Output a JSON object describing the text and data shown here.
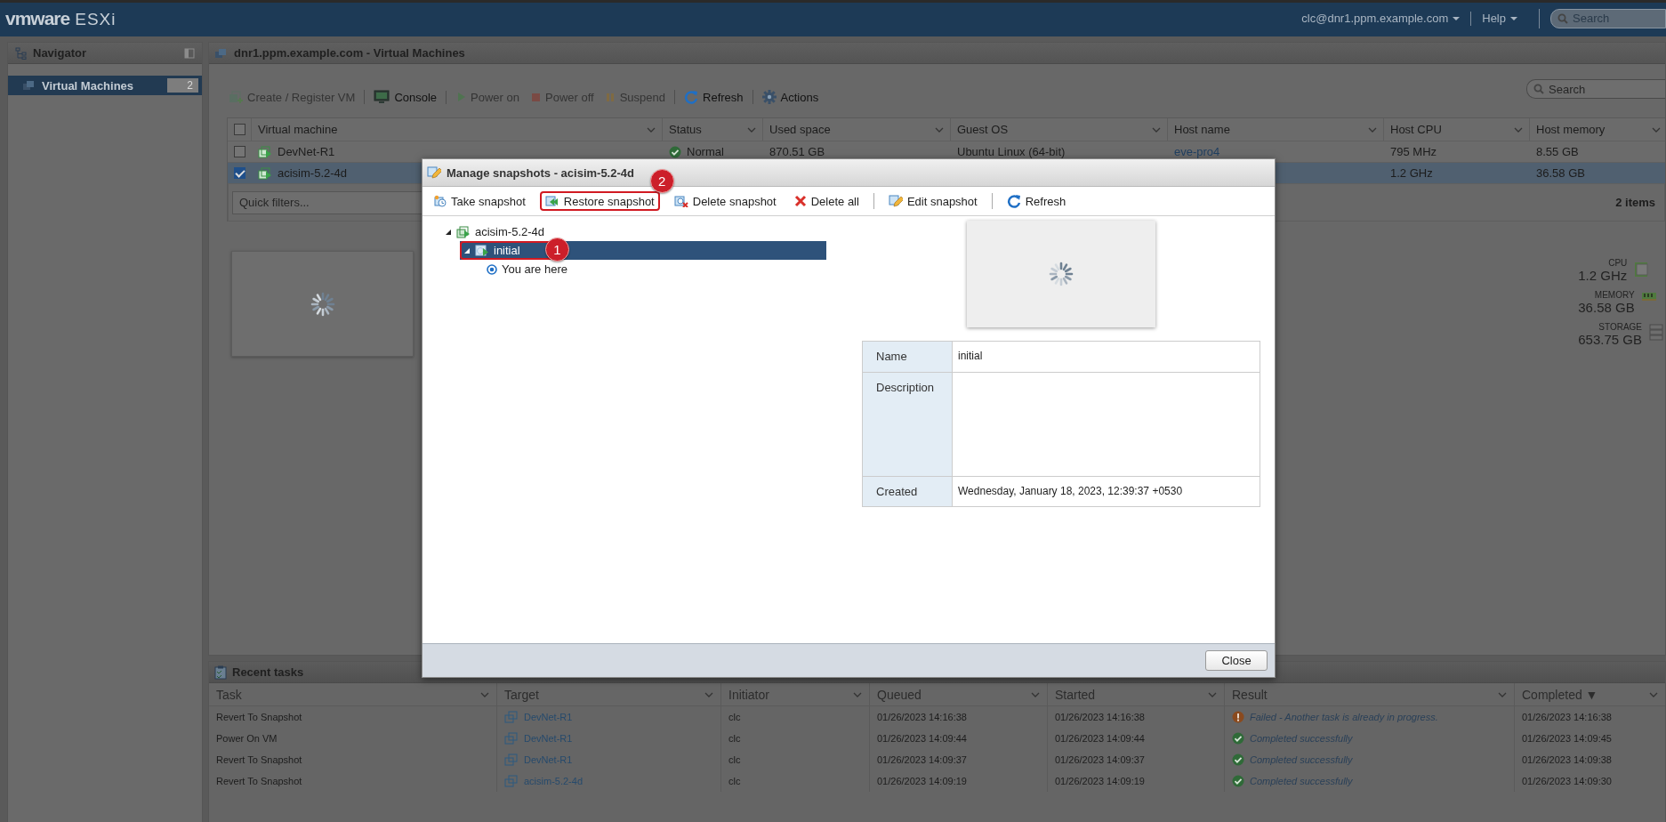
{
  "top_bar": {
    "logo": "vmware",
    "product": "ESXi",
    "user_menu": "clc@dnr1.ppm.example.com",
    "help_menu": "Help",
    "search": {
      "placeholder": "Search"
    }
  },
  "navigator": {
    "title": "Navigator",
    "items": [
      {
        "label": "Virtual Machines",
        "count": "2",
        "selected": true
      }
    ]
  },
  "main": {
    "title": "dnr1.ppm.example.com - Virtual Machines",
    "toolbar": [
      [
        {
          "label": "Create / Register VM",
          "kind": "vm-add",
          "disabled": true
        }
      ],
      [
        {
          "label": "Console",
          "kind": "console",
          "disabled": false
        }
      ],
      [
        {
          "label": "Power on",
          "kind": "power-on",
          "disabled": true
        },
        {
          "label": "Power off",
          "kind": "power-off",
          "disabled": true
        },
        {
          "label": "Suspend",
          "kind": "suspend",
          "disabled": true
        }
      ],
      [
        {
          "label": "Refresh",
          "kind": "refresh",
          "disabled": false
        }
      ],
      [
        {
          "label": "Actions",
          "kind": "actions",
          "disabled": false
        }
      ]
    ],
    "search": {
      "placeholder": "Search"
    },
    "table": {
      "select_all": {
        "checked": false
      },
      "columns": [
        "Virtual machine",
        "Status",
        "Used space",
        "Guest OS",
        "Host name",
        "Host CPU",
        "Host memory"
      ],
      "rows": [
        {
          "checked": false,
          "selected": false,
          "name": "DevNet-R1",
          "status": "Normal",
          "used_space": "870.51 GB",
          "guest_os": "Ubuntu Linux (64-bit)",
          "host_name": "eve-pro4",
          "host_cpu": "795 MHz",
          "host_memory": "8.55 GB"
        },
        {
          "checked": true,
          "selected": true,
          "name": "acisim-5.2-4d",
          "host_cpu": "1.2 GHz",
          "host_memory": "36.58 GB"
        }
      ],
      "filter_placeholder": "Quick filters...",
      "count": "2 items"
    },
    "resources": [
      {
        "label": "CPU",
        "value": "1.2 GHz",
        "kind": "cpu"
      },
      {
        "label": "MEMORY",
        "value": "36.58 GB",
        "kind": "memory"
      },
      {
        "label": "STORAGE",
        "value": "653.75 GB",
        "kind": "storage"
      }
    ]
  },
  "recent_tasks": {
    "title": "Recent tasks",
    "columns": [
      "Task",
      "Target",
      "Initiator",
      "Queued",
      "Started",
      "Result",
      "Completed ▼"
    ],
    "rows": [
      {
        "task": "Revert To Snapshot",
        "target": "DevNet-R1",
        "initiator": "clc",
        "queued": "01/26/2023 14:16:38",
        "started": "01/26/2023 14:16:38",
        "kind": "failed",
        "result": "Failed - Another task is already in progress.",
        "completed": "01/26/2023 14:16:38"
      },
      {
        "task": "Power On VM",
        "target": "DevNet-R1",
        "initiator": "clc",
        "queued": "01/26/2023 14:09:44",
        "started": "01/26/2023 14:09:44",
        "kind": "success",
        "result": "Completed successfully",
        "completed": "01/26/2023 14:09:45"
      },
      {
        "task": "Revert To Snapshot",
        "target": "DevNet-R1",
        "initiator": "clc",
        "queued": "01/26/2023 14:09:37",
        "started": "01/26/2023 14:09:37",
        "kind": "success",
        "result": "Completed successfully",
        "completed": "01/26/2023 14:09:38"
      },
      {
        "task": "Revert To Snapshot",
        "target": "acisim-5.2-4d",
        "initiator": "clc",
        "queued": "01/26/2023 14:09:19",
        "started": "01/26/2023 14:09:19",
        "kind": "success",
        "result": "Completed successfully",
        "completed": "01/26/2023 14:09:30"
      }
    ]
  },
  "dialog": {
    "title": "Manage snapshots - acisim-5.2-4d",
    "toolbar": [
      [
        {
          "label": "Take snapshot",
          "kind": "snap-take"
        },
        {
          "label": "Restore snapshot",
          "kind": "snap-restore",
          "annotation": "2"
        },
        {
          "label": "Delete snapshot",
          "kind": "snap-delete"
        },
        {
          "label": "Delete all",
          "kind": "delete-all"
        }
      ],
      [
        {
          "label": "Edit snapshot",
          "kind": "snap-edit"
        }
      ],
      [
        {
          "label": "Refresh",
          "kind": "refresh"
        }
      ]
    ],
    "tree": [
      {
        "label": "acisim-5.2-4d",
        "kind": "vm",
        "expanded": true,
        "selected": false,
        "children": [
          {
            "label": "initial",
            "kind": "snapshot",
            "expanded": true,
            "selected": true,
            "annotation": "1",
            "children": [
              {
                "label": "You are here",
                "kind": "current",
                "selected": false
              }
            ]
          }
        ]
      }
    ],
    "properties": [
      {
        "label": "Name",
        "value": "initial",
        "kind": "line"
      },
      {
        "label": "Description",
        "kind": "multiline"
      },
      {
        "label": "Created",
        "value": "Wednesday, January 18, 2023, 12:39:37 +0530",
        "kind": "line"
      }
    ],
    "close": "Close"
  }
}
